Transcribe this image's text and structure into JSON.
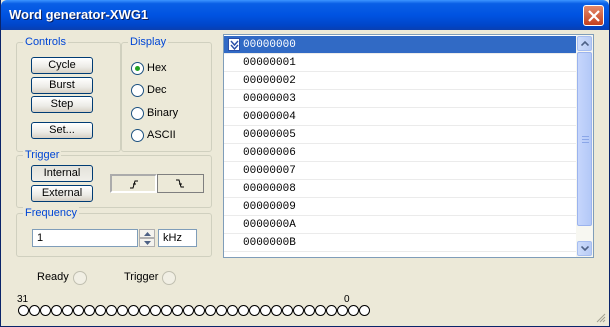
{
  "window": {
    "title": "Word generator-XWG1"
  },
  "controls": {
    "label": "Controls",
    "cycle": "Cycle",
    "burst": "Burst",
    "step": "Step",
    "set": "Set..."
  },
  "display": {
    "label": "Display",
    "options": [
      "Hex",
      "Dec",
      "Binary",
      "ASCII"
    ],
    "selected": "Hex"
  },
  "trigger": {
    "label": "Trigger",
    "internal": "Internal",
    "external": "External",
    "edge_icons": [
      "rising-edge-icon",
      "falling-edge-icon"
    ]
  },
  "frequency": {
    "label": "Frequency",
    "value": "1",
    "unit": "kHz"
  },
  "words": [
    "00000000",
    "00000001",
    "00000002",
    "00000003",
    "00000004",
    "00000005",
    "00000006",
    "00000007",
    "00000008",
    "00000009",
    "0000000A",
    "0000000B"
  ],
  "status": {
    "ready": "Ready",
    "trigger": "Trigger"
  },
  "bits": {
    "high_label": "31",
    "low_label": "0",
    "count": 32
  },
  "colors": {
    "title_bar": "#0053e1",
    "selection": "#316ac5",
    "group_label": "#0046d5",
    "close_button": "#c4401e"
  }
}
